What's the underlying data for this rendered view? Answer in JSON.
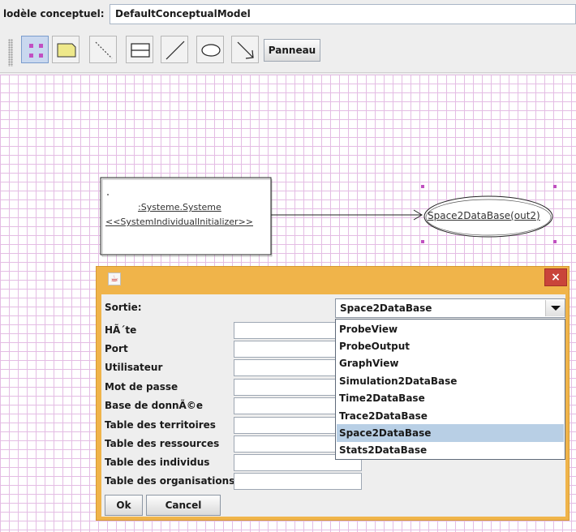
{
  "header": {
    "label": "lodèle conceptuel:",
    "model_name": "DefaultConceptualModel"
  },
  "toolbar": {
    "tools": [
      {
        "name": "selection-tool-icon",
        "active": true
      },
      {
        "name": "note-tool-icon",
        "active": false
      },
      {
        "name": "dotted-line-tool-icon",
        "active": false
      },
      {
        "name": "class-box-tool-icon",
        "active": false
      },
      {
        "name": "line-tool-icon",
        "active": false
      },
      {
        "name": "ellipse-tool-icon",
        "active": false
      },
      {
        "name": "arrow-tool-icon",
        "active": false
      }
    ],
    "panel_button": "Panneau"
  },
  "diagram": {
    "class_box": {
      "name": ":Systeme.Systeme",
      "stereotype": "<<SystemIndividualInitializer>>"
    },
    "ellipse_label": "Space2DataBase(out2)"
  },
  "dialog": {
    "close_symbol": "×",
    "java_icon": "java-cup-icon",
    "output_label": "Sortie:",
    "output_value": "Space2DataBase",
    "fields": [
      {
        "label": "HÃ´te"
      },
      {
        "label": "Port"
      },
      {
        "label": "Utilisateur"
      },
      {
        "label": "Mot de passe"
      },
      {
        "label": "Base de donnÃ©e"
      },
      {
        "label": "Table des territoires"
      },
      {
        "label": "Table des ressources"
      },
      {
        "label": "Table des individus"
      },
      {
        "label": "Table des organisations"
      }
    ],
    "dropdown_options": [
      "ProbeView",
      "ProbeOutput",
      "GraphView",
      "Simulation2DataBase",
      "Time2DataBase",
      "Trace2DataBase",
      "Space2DataBase",
      "Stats2DataBase"
    ],
    "selected_option": "Space2DataBase",
    "ok_label": "Ok",
    "cancel_label": "Cancel"
  },
  "colors": {
    "grid": "#e4bde4",
    "dialog_frame": "#f0b44a",
    "selection": "#b8cfe5",
    "handle": "#c050c0"
  }
}
